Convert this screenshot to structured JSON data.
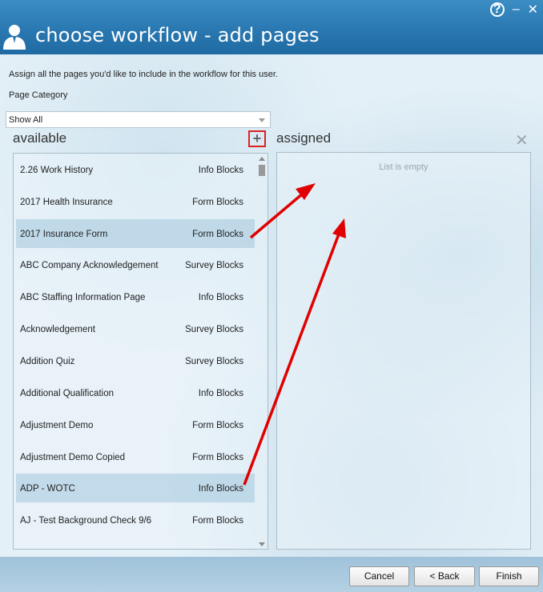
{
  "header": {
    "title": "choose workflow - add pages",
    "help": "?",
    "minimize": "–",
    "close": "✕"
  },
  "instruction": "Assign all the pages you'd like to include in the workflow for this user.",
  "page_category": {
    "label": "Page Category",
    "selected": "Show All"
  },
  "available": {
    "title": "available",
    "add_symbol": "+",
    "items": [
      {
        "name": "2.26 Work History",
        "type": "Info Blocks"
      },
      {
        "name": "2017 Health Insurance",
        "type": "Form Blocks"
      },
      {
        "name": "2017 Insurance Form",
        "type": "Form Blocks"
      },
      {
        "name": "ABC Company Acknowledgement",
        "type": "Survey Blocks"
      },
      {
        "name": "ABC Staffing Information Page",
        "type": "Info Blocks"
      },
      {
        "name": "Acknowledgement",
        "type": "Survey Blocks"
      },
      {
        "name": "Addition Quiz",
        "type": "Survey Blocks"
      },
      {
        "name": "Additional Qualification",
        "type": "Info Blocks"
      },
      {
        "name": "Adjustment Demo",
        "type": "Form Blocks"
      },
      {
        "name": "Adjustment Demo Copied",
        "type": "Form Blocks"
      },
      {
        "name": "ADP - WOTC",
        "type": "Info Blocks"
      },
      {
        "name": "AJ - Test Background Check 9/6",
        "type": "Form Blocks"
      }
    ]
  },
  "assigned": {
    "title": "assigned",
    "clear_symbol": "✕",
    "empty_text": "List is empty"
  },
  "footer": {
    "cancel": "Cancel",
    "back": "< Back",
    "finish": "Finish"
  },
  "colors": {
    "header": "#2a78b1",
    "highlight": "#a3c7dc",
    "arrow": "#e00000",
    "add_border": "#d22222"
  }
}
